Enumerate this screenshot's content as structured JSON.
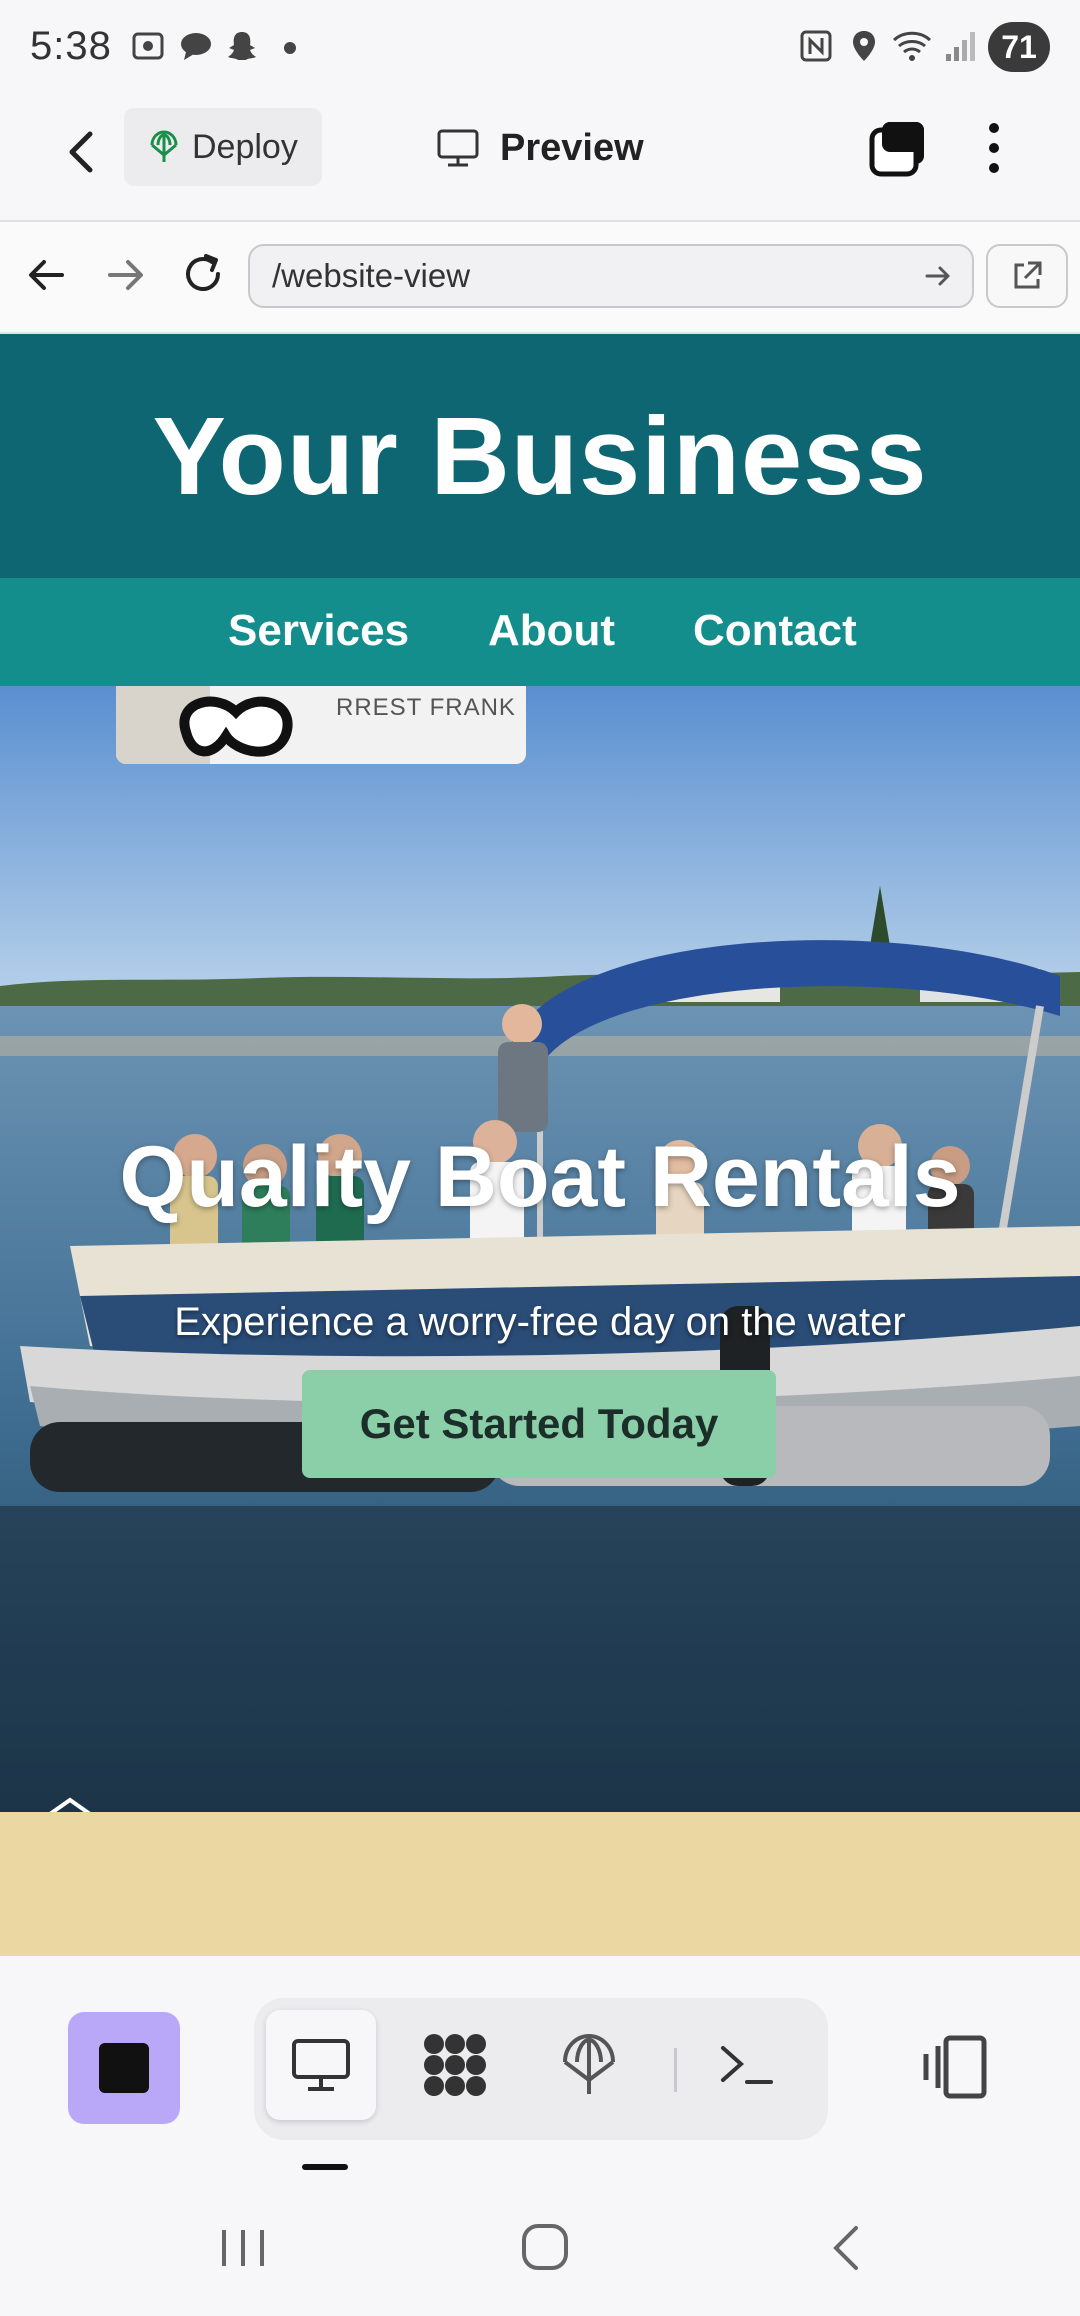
{
  "status_bar": {
    "time": "5:38",
    "battery": "71",
    "icons": [
      "screenshot-icon",
      "chat-bubble-icon",
      "snapchat-icon",
      "dot-icon",
      "nfc-icon",
      "location-icon",
      "wifi-icon",
      "signal-icon"
    ]
  },
  "toolbar": {
    "deploy_label": "Deploy",
    "preview_label": "Preview"
  },
  "browser": {
    "url": "/website-view"
  },
  "site": {
    "title": "Your Business",
    "nav": [
      "Services",
      "About",
      "Contact"
    ],
    "hero_heading": "Quality Boat Rentals",
    "hero_subheading": "Experience a worry-free day on the water",
    "cta_label": "Get Started Today",
    "logo_caption": "RREST FRANK",
    "colors": {
      "header": "#0d6672",
      "nav": "#138e8c",
      "cta": "#8bcfa9",
      "sand": "#ead7a2"
    }
  },
  "bottom_toolbar": {
    "accent": "#b9a8f7",
    "modes": [
      "preview-icon",
      "grid-icon",
      "deploy-icon",
      "terminal-icon"
    ]
  }
}
